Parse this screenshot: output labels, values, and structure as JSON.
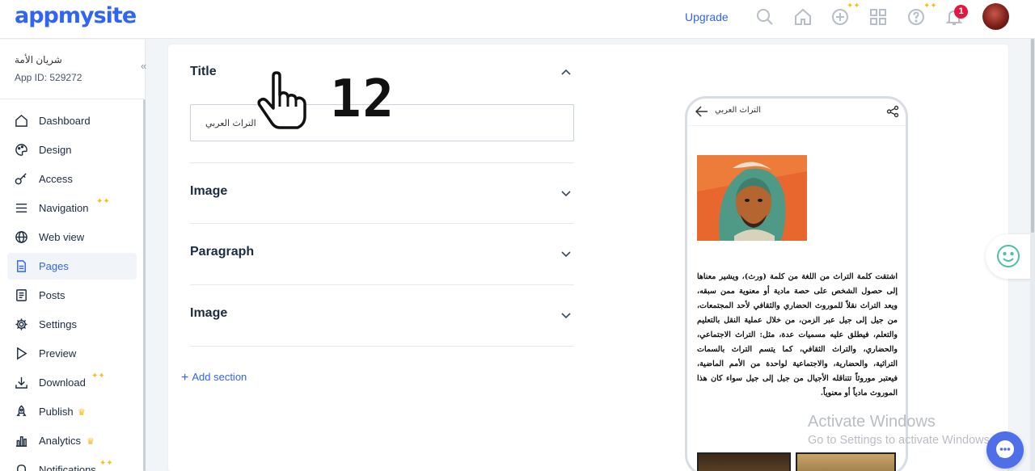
{
  "header": {
    "logo": "appmysite",
    "upgrade_label": "Upgrade",
    "notification_count": "1",
    "icons": [
      "search-icon",
      "home-icon",
      "add-circle-icon",
      "apps-grid-icon",
      "help-icon",
      "bell-icon"
    ]
  },
  "sidebar": {
    "app_name": "شريان الأمة",
    "app_id": "App ID: 529272",
    "collapse_glyph": "«",
    "items": [
      {
        "label": "Dashboard",
        "icon": "dashboard-icon"
      },
      {
        "label": "Design",
        "icon": "palette-icon"
      },
      {
        "label": "Access",
        "icon": "key-icon"
      },
      {
        "label": "Navigation",
        "icon": "list-icon"
      },
      {
        "label": "Web view",
        "icon": "globe-icon"
      },
      {
        "label": "Pages",
        "icon": "page-icon"
      },
      {
        "label": "Posts",
        "icon": "posts-icon"
      },
      {
        "label": "Settings",
        "icon": "gear-icon"
      },
      {
        "label": "Preview",
        "icon": "play-icon"
      },
      {
        "label": "Download",
        "icon": "download-icon"
      },
      {
        "label": "Publish",
        "icon": "rocket-icon"
      },
      {
        "label": "Analytics",
        "icon": "bar-chart-icon"
      },
      {
        "label": "Notifications",
        "icon": "bell-icon"
      }
    ],
    "active_item": "Pages"
  },
  "editor": {
    "sections": [
      {
        "label": "Title",
        "expanded": true
      },
      {
        "label": "Image",
        "expanded": false
      },
      {
        "label": "Paragraph",
        "expanded": false
      },
      {
        "label": "Image",
        "expanded": false
      }
    ],
    "title_value": "التراث العربي",
    "add_section_label": "Add section"
  },
  "overlay": {
    "number": "12"
  },
  "preview": {
    "title": "التراث العربي",
    "paragraph": "اشتقت كلمة التراث من اللغة من كلمة (ورث)، ويشير معناها إلى حصول الشخص على حصة مادية أو معنوية ممن سبقه، ويعد التراث نقلاً للموروث الحضاري والثقافي لأحد المجتمعات، من جيل إلى جيل عبر الزمن، من خلال عملية النقل بالتعليم والتعلم، فيطلق عليه مسميات عدة، مثل: التراث الاجتماعي، والحضاري، والتراث الثقافي، كما يتسم التراث بالسمات التراثية، والحضارية، والاجتماعية لواحدة من الأمم الماضية، فيعتبر موروثاً تتناقله الأجيال من جيل إلى جيل سواء كان هذا الموروث مادياً أو معنوياً."
  },
  "watermark": {
    "line1": "Activate Windows",
    "line2": "Go to Settings to activate Windows."
  },
  "colors": {
    "brand": "#3064f6",
    "badge": "#e3173e",
    "sparkle": "#f4c21b",
    "feedback": "#4cc1a3"
  }
}
